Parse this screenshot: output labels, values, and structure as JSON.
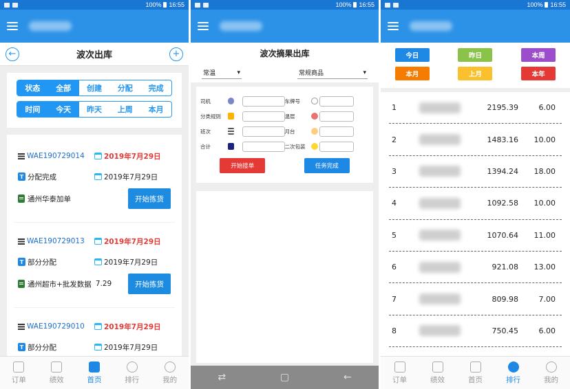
{
  "status": {
    "time": "16:55",
    "battery": "100%"
  },
  "screen1": {
    "title": "波次出库",
    "back_icon": "arrow-left-circle-icon",
    "add_icon": "plus-circle-icon",
    "status_filter": [
      "状态",
      "全部",
      "创建",
      "分配",
      "完成"
    ],
    "time_filter": [
      "时间",
      "今天",
      "昨天",
      "上周",
      "本月"
    ],
    "orders": [
      {
        "code": "WAE190729014",
        "date": "2019年7月29日",
        "status": "分配完成",
        "date2": "2019年7月29日",
        "customer": "通州华泰加单",
        "extra": "",
        "button": "开始拣货"
      },
      {
        "code": "WAE190729013",
        "date": "2019年7月29日",
        "status": "部分分配",
        "date2": "2019年7月29日",
        "customer": "通州超市+批发数据",
        "extra": "7.29",
        "button": "开始拣货"
      },
      {
        "code": "WAE190729010",
        "date": "2019年7月29日",
        "status": "部分分配",
        "date2": "2019年7月29日",
        "customer": "",
        "extra": "",
        "button": ""
      }
    ]
  },
  "tabs": [
    "订单",
    "绩效",
    "首页",
    "排行",
    "我的"
  ],
  "screen2": {
    "title": "波次摘果出库",
    "select_temp": "常温",
    "select_goods": "常规商品",
    "fields_left": [
      "司机",
      "分类规则",
      "班次",
      "合计"
    ],
    "fields_right": [
      "车牌号",
      "温层",
      "月台",
      "二次包装"
    ],
    "btn_start": "开始接单",
    "btn_done": "任务完成"
  },
  "screen3": {
    "chips": [
      {
        "label": "今日",
        "color": "#1e88e5"
      },
      {
        "label": "昨日",
        "color": "#8bc34a"
      },
      {
        "label": "本周",
        "color": "#9c4dcc"
      },
      {
        "label": "本月",
        "color": "#f57c00"
      },
      {
        "label": "上月",
        "color": "#fbc02d"
      },
      {
        "label": "本年",
        "color": "#e53935"
      }
    ],
    "ranking": [
      {
        "rank": "1",
        "amount": "2195.39",
        "count": "6.00"
      },
      {
        "rank": "2",
        "amount": "1483.16",
        "count": "10.00"
      },
      {
        "rank": "3",
        "amount": "1394.24",
        "count": "18.00"
      },
      {
        "rank": "4",
        "amount": "1092.58",
        "count": "10.00"
      },
      {
        "rank": "5",
        "amount": "1070.64",
        "count": "11.00"
      },
      {
        "rank": "6",
        "amount": "921.08",
        "count": "13.00"
      },
      {
        "rank": "7",
        "amount": "809.98",
        "count": "7.00"
      },
      {
        "rank": "8",
        "amount": "750.45",
        "count": "6.00"
      }
    ]
  }
}
